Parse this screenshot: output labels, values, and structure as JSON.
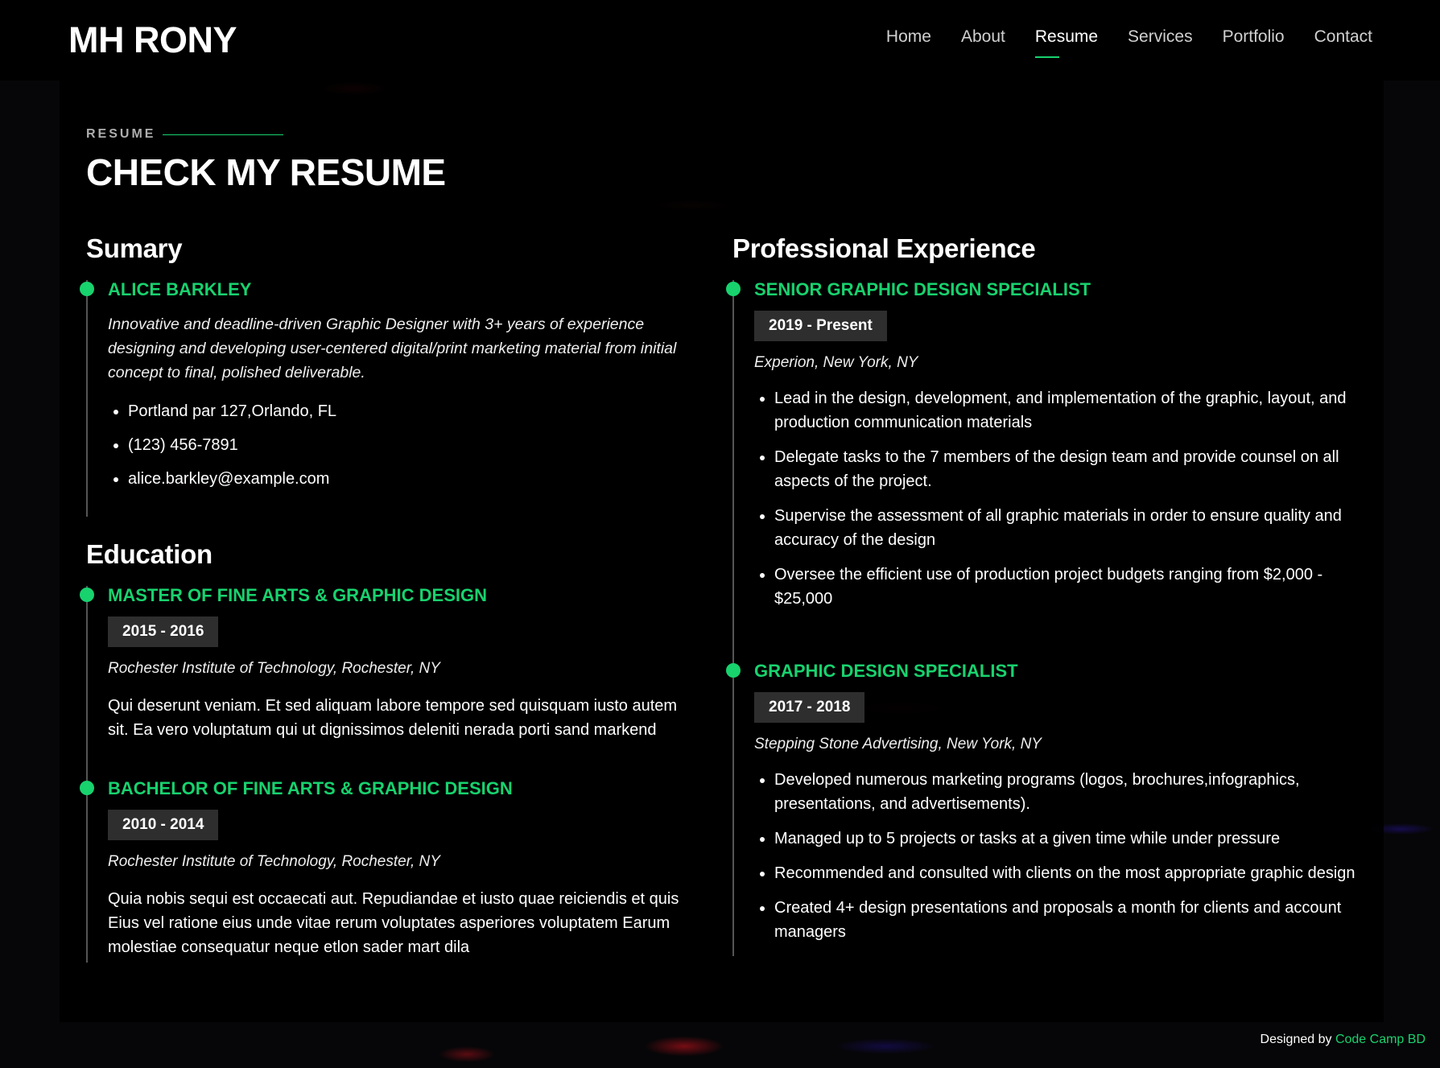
{
  "brand": "MH RONY",
  "nav": {
    "items": [
      "Home",
      "About",
      "Resume",
      "Services",
      "Portfolio",
      "Contact"
    ],
    "active": "Resume"
  },
  "section": {
    "label": "RESUME",
    "heading": "CHECK MY RESUME"
  },
  "summary": {
    "heading": "Sumary",
    "name": "ALICE BARKLEY",
    "bio": "Innovative and deadline-driven Graphic Designer with 3+ years of experience designing and developing user-centered digital/print marketing material from initial concept to final, polished deliverable.",
    "contacts": [
      "Portland par 127,Orlando, FL",
      "(123) 456-7891",
      "alice.barkley@example.com"
    ]
  },
  "education": {
    "heading": "Education",
    "items": [
      {
        "title": "MASTER OF FINE ARTS & GRAPHIC DESIGN",
        "date": "2015 - 2016",
        "institution": "Rochester Institute of Technology, Rochester, NY",
        "description": "Qui deserunt veniam. Et sed aliquam labore tempore sed quisquam iusto autem sit. Ea vero voluptatum qui ut dignissimos deleniti nerada porti sand markend"
      },
      {
        "title": "BACHELOR OF FINE ARTS & GRAPHIC DESIGN",
        "date": "2010 - 2014",
        "institution": "Rochester Institute of Technology, Rochester, NY",
        "description": "Quia nobis sequi est occaecati aut. Repudiandae et iusto quae reiciendis et quis Eius vel ratione eius unde vitae rerum voluptates asperiores voluptatem Earum molestiae consequatur neque etlon sader mart dila"
      }
    ]
  },
  "experience": {
    "heading": "Professional Experience",
    "items": [
      {
        "title": "SENIOR GRAPHIC DESIGN SPECIALIST",
        "date": "2019 - Present",
        "company": "Experion, New York, NY",
        "bullets": [
          "Lead in the design, development, and implementation of the graphic, layout, and production communication materials",
          "Delegate tasks to the 7 members of the design team and provide counsel on all aspects of the project.",
          "Supervise the assessment of all graphic materials in order to ensure quality and accuracy of the design",
          "Oversee the efficient use of production project budgets ranging from $2,000 - $25,000"
        ]
      },
      {
        "title": "GRAPHIC DESIGN SPECIALIST",
        "date": "2017 - 2018",
        "company": "Stepping Stone Advertising, New York, NY",
        "bullets": [
          "Developed numerous marketing programs (logos, brochures,infographics, presentations, and advertisements).",
          "Managed up to 5 projects or tasks at a given time while under pressure",
          "Recommended and consulted with clients on the most appropriate graphic design",
          "Created 4+ design presentations and proposals a month for clients and account managers"
        ]
      }
    ]
  },
  "footer": {
    "prefix": "Designed by",
    "brand": "Code Camp BD"
  },
  "colors": {
    "accent": "#18d26e",
    "background": "#000000",
    "date_badge": "#2e2e2e"
  }
}
